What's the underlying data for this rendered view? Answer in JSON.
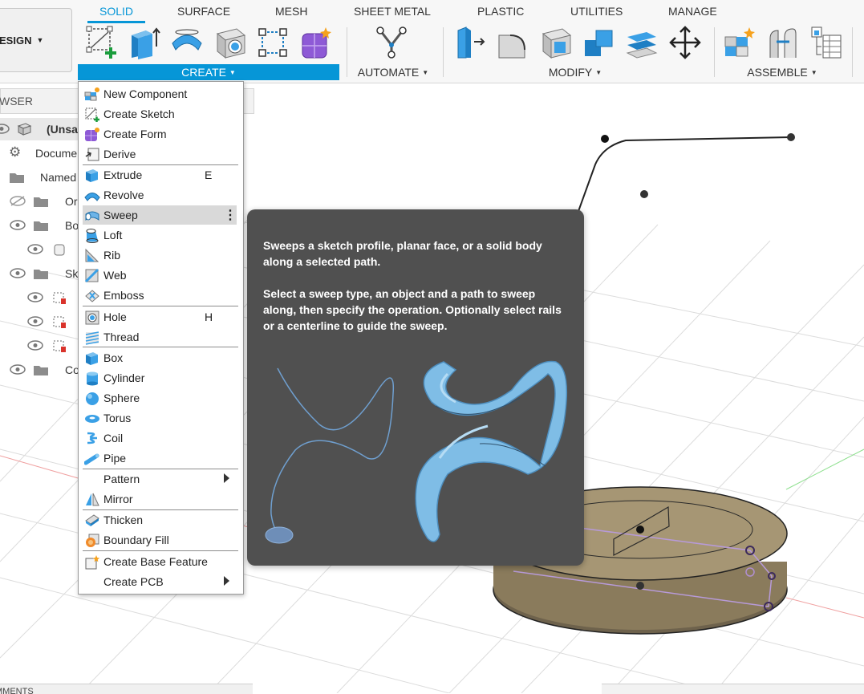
{
  "toolbar": {
    "workspace_label": "ESIGN",
    "tabs": [
      {
        "label": "SOLID",
        "active": true
      },
      {
        "label": "SURFACE"
      },
      {
        "label": "MESH"
      },
      {
        "label": "SHEET METAL"
      },
      {
        "label": "PLASTIC"
      },
      {
        "label": "UTILITIES"
      },
      {
        "label": "MANAGE"
      }
    ],
    "groups": {
      "create": "CREATE",
      "automate": "AUTOMATE",
      "modify": "MODIFY",
      "assemble": "ASSEMBLE"
    },
    "accent_color": "#0696d7"
  },
  "browser": {
    "header": "WSER",
    "rows": [
      {
        "label": "(Unsa"
      },
      {
        "label": "Docume"
      },
      {
        "label": "Named"
      },
      {
        "label": "Or"
      },
      {
        "label": "Bo"
      },
      {
        "label": ""
      },
      {
        "label": "Sk"
      },
      {
        "label": ""
      },
      {
        "label": ""
      },
      {
        "label": ""
      },
      {
        "label": "Co"
      }
    ]
  },
  "create_menu": {
    "items": [
      {
        "label": "New Component",
        "icon": "new-component-icon"
      },
      {
        "label": "Create Sketch",
        "icon": "create-sketch-icon"
      },
      {
        "label": "Create Form",
        "icon": "create-form-icon"
      },
      {
        "label": "Derive",
        "icon": "derive-icon"
      },
      {
        "label": "Extrude",
        "icon": "extrude-icon",
        "shortcut": "E"
      },
      {
        "label": "Revolve",
        "icon": "revolve-icon"
      },
      {
        "label": "Sweep",
        "icon": "sweep-icon",
        "highlighted": true
      },
      {
        "label": "Loft",
        "icon": "loft-icon"
      },
      {
        "label": "Rib",
        "icon": "rib-icon"
      },
      {
        "label": "Web",
        "icon": "web-icon"
      },
      {
        "label": "Emboss",
        "icon": "emboss-icon"
      },
      {
        "label": "Hole",
        "icon": "hole-icon",
        "shortcut": "H"
      },
      {
        "label": "Thread",
        "icon": "thread-icon"
      },
      {
        "label": "Box",
        "icon": "box-icon"
      },
      {
        "label": "Cylinder",
        "icon": "cylinder-icon"
      },
      {
        "label": "Sphere",
        "icon": "sphere-icon"
      },
      {
        "label": "Torus",
        "icon": "torus-icon"
      },
      {
        "label": "Coil",
        "icon": "coil-icon"
      },
      {
        "label": "Pipe",
        "icon": "pipe-icon"
      },
      {
        "label": "Pattern",
        "icon": "",
        "submenu": true
      },
      {
        "label": "Mirror",
        "icon": "mirror-icon"
      },
      {
        "label": "Thicken",
        "icon": "thicken-icon"
      },
      {
        "label": "Boundary Fill",
        "icon": "boundary-fill-icon"
      },
      {
        "label": "Create Base Feature",
        "icon": "create-base-feature-icon"
      },
      {
        "label": "Create PCB",
        "icon": "",
        "submenu": true
      }
    ]
  },
  "tooltip": {
    "paragraph_1": "Sweeps a sketch profile, planar face, or a solid body along a selected path.",
    "paragraph_2": "Select a sweep type, an object and a path to sweep along, then specify the operation. Optionally select rails or a centerline to guide the sweep.",
    "background_color": "#505050",
    "sweep_color": "#7fbde6"
  },
  "bottom": {
    "comments_label": "MMENTS"
  }
}
